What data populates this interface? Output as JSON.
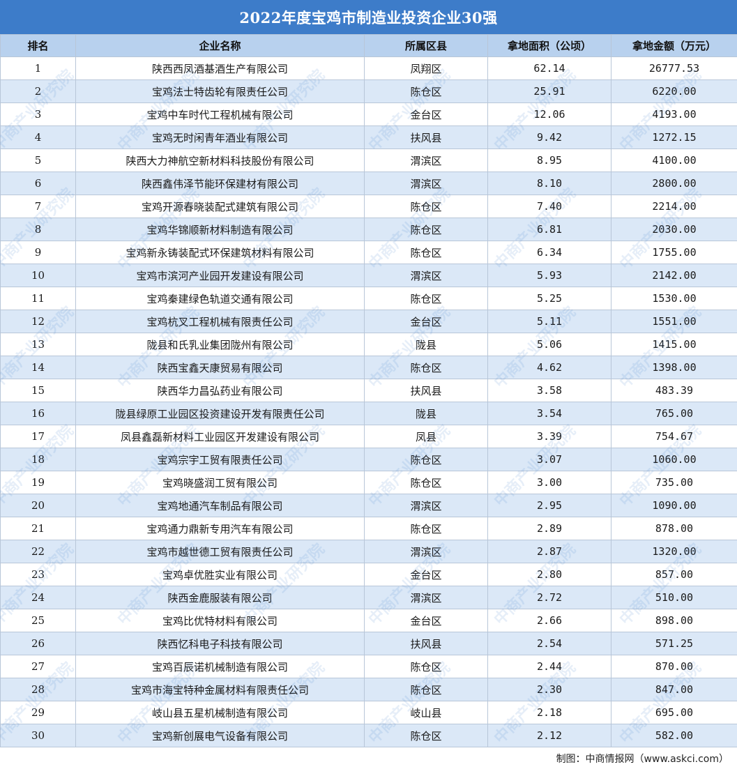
{
  "title": "2022年度宝鸡市制造业投资企业30强",
  "headers": {
    "rank": "排名",
    "name": "企业名称",
    "district": "所属区县",
    "area": "拿地面积（公顷）",
    "amount": "拿地金额（万元）"
  },
  "rows": [
    {
      "rank": "1",
      "name": "陕西西凤酒基酒生产有限公司",
      "district": "凤翔区",
      "area": "62.14",
      "amount": "26777.53"
    },
    {
      "rank": "2",
      "name": "宝鸡法士特齿轮有限责任公司",
      "district": "陈仓区",
      "area": "25.91",
      "amount": "6220.00"
    },
    {
      "rank": "3",
      "name": "宝鸡中车时代工程机械有限公司",
      "district": "金台区",
      "area": "12.06",
      "amount": "4193.00"
    },
    {
      "rank": "4",
      "name": "宝鸡无时闲青年酒业有限公司",
      "district": "扶风县",
      "area": "9.42",
      "amount": "1272.15"
    },
    {
      "rank": "5",
      "name": "陕西大力神航空新材料科技股份有限公司",
      "district": "渭滨区",
      "area": "8.95",
      "amount": "4100.00"
    },
    {
      "rank": "6",
      "name": "陕西鑫伟泽节能环保建材有限公司",
      "district": "渭滨区",
      "area": "8.10",
      "amount": "2800.00"
    },
    {
      "rank": "7",
      "name": "宝鸡开源春晓装配式建筑有限公司",
      "district": "陈仓区",
      "area": "7.40",
      "amount": "2214.00"
    },
    {
      "rank": "8",
      "name": "宝鸡华锦顺新材料制造有限公司",
      "district": "陈仓区",
      "area": "6.81",
      "amount": "2030.00"
    },
    {
      "rank": "9",
      "name": "宝鸡新永铸装配式环保建筑材料有限公司",
      "district": "陈仓区",
      "area": "6.34",
      "amount": "1755.00"
    },
    {
      "rank": "10",
      "name": "宝鸡市滨河产业园开发建设有限公司",
      "district": "渭滨区",
      "area": "5.93",
      "amount": "2142.00"
    },
    {
      "rank": "11",
      "name": "宝鸡秦建绿色轨道交通有限公司",
      "district": "陈仓区",
      "area": "5.25",
      "amount": "1530.00"
    },
    {
      "rank": "12",
      "name": "宝鸡杭叉工程机械有限责任公司",
      "district": "金台区",
      "area": "5.11",
      "amount": "1551.00"
    },
    {
      "rank": "13",
      "name": "陇县和氏乳业集团陇州有限公司",
      "district": "陇县",
      "area": "5.06",
      "amount": "1415.00"
    },
    {
      "rank": "14",
      "name": "陕西宝鑫天康贸易有限公司",
      "district": "陈仓区",
      "area": "4.62",
      "amount": "1398.00"
    },
    {
      "rank": "15",
      "name": "陕西华力昌弘药业有限公司",
      "district": "扶风县",
      "area": "3.58",
      "amount": "483.39"
    },
    {
      "rank": "16",
      "name": "陇县绿原工业园区投资建设开发有限责任公司",
      "district": "陇县",
      "area": "3.54",
      "amount": "765.00"
    },
    {
      "rank": "17",
      "name": "凤县鑫磊新材料工业园区开发建设有限公司",
      "district": "凤县",
      "area": "3.39",
      "amount": "754.67"
    },
    {
      "rank": "18",
      "name": "宝鸡宗宇工贸有限责任公司",
      "district": "陈仓区",
      "area": "3.07",
      "amount": "1060.00"
    },
    {
      "rank": "19",
      "name": "宝鸡晓盛润工贸有限公司",
      "district": "陈仓区",
      "area": "3.00",
      "amount": "735.00"
    },
    {
      "rank": "20",
      "name": "宝鸡地通汽车制品有限公司",
      "district": "渭滨区",
      "area": "2.95",
      "amount": "1090.00"
    },
    {
      "rank": "21",
      "name": "宝鸡通力鼎新专用汽车有限公司",
      "district": "陈仓区",
      "area": "2.89",
      "amount": "878.00"
    },
    {
      "rank": "22",
      "name": "宝鸡市越世德工贸有限责任公司",
      "district": "渭滨区",
      "area": "2.87",
      "amount": "1320.00"
    },
    {
      "rank": "23",
      "name": "宝鸡卓优胜实业有限公司",
      "district": "金台区",
      "area": "2.80",
      "amount": "857.00"
    },
    {
      "rank": "24",
      "name": "陕西金鹿服装有限公司",
      "district": "渭滨区",
      "area": "2.72",
      "amount": "510.00"
    },
    {
      "rank": "25",
      "name": "宝鸡比优特材料有限公司",
      "district": "金台区",
      "area": "2.66",
      "amount": "898.00"
    },
    {
      "rank": "26",
      "name": "陕西忆科电子科技有限公司",
      "district": "扶风县",
      "area": "2.54",
      "amount": "571.25"
    },
    {
      "rank": "27",
      "name": "宝鸡百辰诺机械制造有限公司",
      "district": "陈仓区",
      "area": "2.44",
      "amount": "870.00"
    },
    {
      "rank": "28",
      "name": "宝鸡市海宝特种金属材料有限责任公司",
      "district": "陈仓区",
      "area": "2.30",
      "amount": "847.00"
    },
    {
      "rank": "29",
      "name": "岐山县五星机械制造有限公司",
      "district": "岐山县",
      "area": "2.18",
      "amount": "695.00"
    },
    {
      "rank": "30",
      "name": "宝鸡新创展电气设备有限公司",
      "district": "陈仓区",
      "area": "2.12",
      "amount": "582.00"
    }
  ],
  "footer": "制图：中商情报网（www.askci.com）",
  "watermark": "中商产业研究院",
  "colors": {
    "title_bg": "#3d7cc9",
    "header_bg": "#b8d1ee",
    "row_alt_bg": "#dbe8f7",
    "border": "#b8c6d8"
  }
}
